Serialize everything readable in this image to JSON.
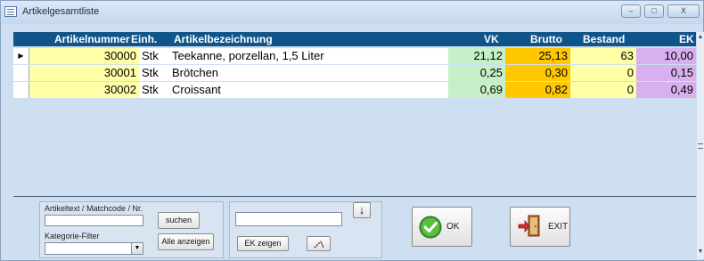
{
  "window": {
    "title": "Artikelgesamtliste",
    "buttons": {
      "minimize": "–",
      "maximize": "□",
      "close": "X"
    }
  },
  "grid": {
    "columns": [
      "Artikelnummer",
      "Einh.",
      "Artikelbezeichnung",
      "VK",
      "Brutto",
      "Bestand",
      "EK"
    ],
    "rows": [
      {
        "selected": true,
        "nr": "30000",
        "unit": "Stk",
        "desc": "Teekanne, porzellan, 1,5 Liter",
        "vk": "21,12",
        "brutto": "25,13",
        "bestand": "63",
        "ek": "10,00"
      },
      {
        "selected": false,
        "nr": "30001",
        "unit": "Stk",
        "desc": "Brötchen",
        "vk": "0,25",
        "brutto": "0,30",
        "bestand": "0",
        "ek": "0,15"
      },
      {
        "selected": false,
        "nr": "30002",
        "unit": "Stk",
        "desc": "Croissant",
        "vk": "0,69",
        "brutto": "0,82",
        "bestand": "0",
        "ek": "0,49"
      }
    ],
    "row_marker": "▶"
  },
  "search": {
    "text_label": "Artikeltext / Matchcode / Nr.",
    "text_value": "",
    "category_label": "Kategorie-Filter",
    "category_value": "",
    "search_button": "suchen",
    "show_all_button": "Alle anzeigen"
  },
  "ek_panel": {
    "input_value": "",
    "ek_button": "EK zeigen",
    "down_arrow": "↓"
  },
  "actions": {
    "ok": "OK",
    "exit": "EXIT"
  },
  "colors": {
    "header_bg": "#10558a",
    "nr_bg": "#ffffa8",
    "vk_bg": "#c8f0c8",
    "brutto_bg": "#ffc800",
    "bestand_bg": "#ffffa8",
    "ek_bg": "#d8b0ee",
    "window_bg": "#cfdff2"
  }
}
